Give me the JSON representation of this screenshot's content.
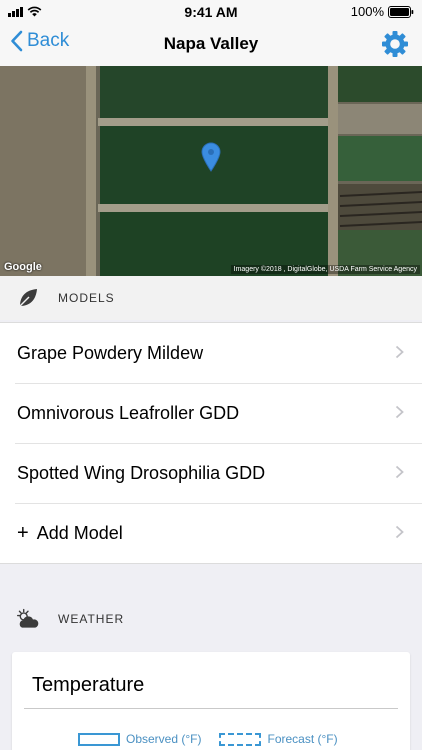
{
  "status_bar": {
    "time": "9:41 AM",
    "battery": "100%"
  },
  "nav": {
    "back_label": "Back",
    "title": "Napa Valley"
  },
  "map": {
    "google_logo": "Google",
    "attribution": "Imagery ©2018 , DigitalGlobe, USDA Farm Service Agency"
  },
  "models": {
    "header": "MODELS",
    "items": [
      {
        "label": "Grape Powdery Mildew"
      },
      {
        "label": "Omnivorous Leafroller GDD"
      },
      {
        "label": "Spotted Wing Drosophilia GDD"
      }
    ],
    "add_label": "Add Model",
    "add_symbol": "+"
  },
  "weather": {
    "header": "WEATHER",
    "card_title": "Temperature",
    "legend": {
      "observed": "Observed (°F)",
      "forecast": "Forecast (°F)"
    }
  },
  "colors": {
    "accent": "#2f8dd6",
    "series": "#3a97d4"
  },
  "icons": [
    "signal-icon",
    "wifi-icon",
    "battery-icon",
    "chevron-left-icon",
    "gear-icon",
    "map-pin-icon",
    "leaf-icon",
    "chevron-right-icon",
    "sun-cloud-icon"
  ]
}
